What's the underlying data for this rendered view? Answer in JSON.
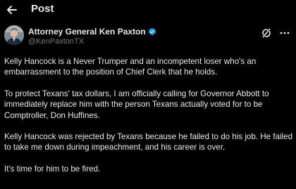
{
  "header": {
    "title": "Post",
    "back_icon": "arrow-left-icon"
  },
  "author": {
    "name": "Attorney General Ken Paxton",
    "handle": "@KenPaxtonTX",
    "verified_color": "#1d9bf0"
  },
  "actions": {
    "grok_icon": "grok-icon",
    "more_icon": "more-icon"
  },
  "post": {
    "paragraphs": [
      "Kelly Hancock is a Never Trumper and an incompetent loser who's an embarrassment to the position of Chief Clerk that he holds.",
      "To protect Texans' tax dollars, I am officially calling for Governor Abbott to immediately replace him with the person Texans actually voted for to be Comptroller, Don Huffines.",
      "Kelly Hancock was rejected by Texans because he failed to do his job. He failed to take me down during impeachment, and his career is over.",
      "It's time for him to be fired."
    ]
  },
  "colors": {
    "background": "#000000",
    "text": "#e7e9ea",
    "secondary": "#71767b",
    "accent": "#1d9bf0"
  }
}
